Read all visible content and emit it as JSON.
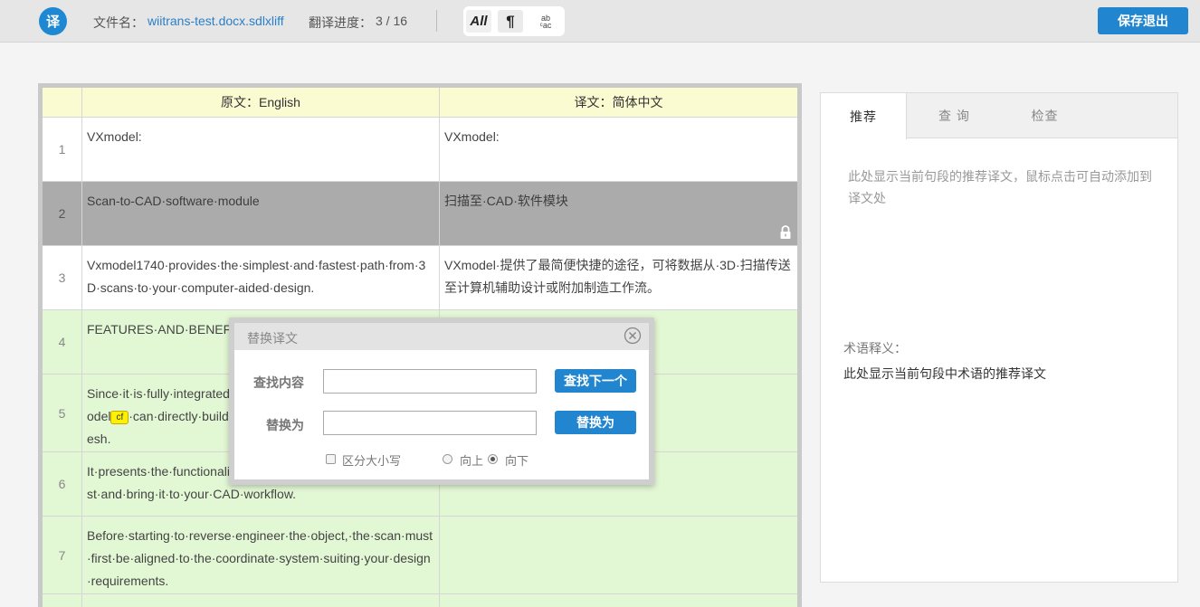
{
  "header": {
    "logo": "译",
    "file_label": "文件名：",
    "file_name": "wiitrans-test.docx.sdlxliff",
    "progress_label": "翻译进度：",
    "progress_value": "3 / 16",
    "progress_fraction": 0.1875,
    "tools": {
      "all": "All",
      "para": "¶",
      "case_top": "ab",
      "case_bottom": "ᶜac"
    },
    "save_button": "保存退出"
  },
  "table": {
    "header": {
      "source": "原文：English",
      "target": "译文：简体中文"
    },
    "rows": [
      {
        "num": "1",
        "source": "VXmodel:",
        "target": "VXmodel:",
        "state": "white"
      },
      {
        "num": "2",
        "source": "Scan-to-CAD·software·module",
        "target": "扫描至·CAD·软件模块",
        "state": "locked"
      },
      {
        "num": "3",
        "source": "Vxmodel1740·provides·the·simplest·and·fastest·path·from·3D·scans·to·your·computer-aided·design.",
        "target": "VXmodel·提供了最简便快捷的途径，可将数据从·3D·扫描传送至计算机辅助设计或附加制造工作流。",
        "state": "white"
      },
      {
        "num": "4",
        "source": "FEATURES·AND·BENEFITS",
        "target": "",
        "state": "green"
      },
      {
        "num": "5",
        "source_a": "Since·it·is·fully·integrated·i",
        "source_b": "odel",
        "source_tag": "cf",
        "source_c": "·can·directly·build",
        "source_d": "esh.",
        "target": "",
        "state": "green"
      },
      {
        "num": "6",
        "source_a": "It·presents·the·functionali",
        "source_b": "st·and·bring·it·to·your·CAD·workflow.",
        "target": "",
        "state": "green"
      },
      {
        "num": "7",
        "source": "Before·starting·to·reverse·engineer·the·object,·the·scan·must·first·be·aligned·to·the·coordinate·system·suiting·your·design·requirements.",
        "target": "",
        "state": "green"
      }
    ]
  },
  "panel": {
    "tabs": [
      "推荐",
      "查 询",
      "检查"
    ],
    "active_tab": 0,
    "recommend_hint": "此处显示当前句段的推荐译文，鼠标点击可自动添加到译文处",
    "term_label": "术语释义：",
    "term_hint": "此处显示当前句段中术语的推荐译文"
  },
  "dialog": {
    "title": "替换译文",
    "find_label": "查找内容",
    "find_value": "",
    "replace_label": "替换为",
    "replace_value": "",
    "find_next_button": "查找下一个",
    "replace_button": "替换为",
    "match_case_label": "区分大小写",
    "match_case_checked": false,
    "direction_up_label": "向上",
    "direction_down_label": "向下",
    "direction": "down"
  },
  "colors": {
    "accent": "#2185d0",
    "header_bg": "#fbfbd2",
    "locked_bg": "#ababab",
    "pending_bg": "#e2f7d4"
  }
}
